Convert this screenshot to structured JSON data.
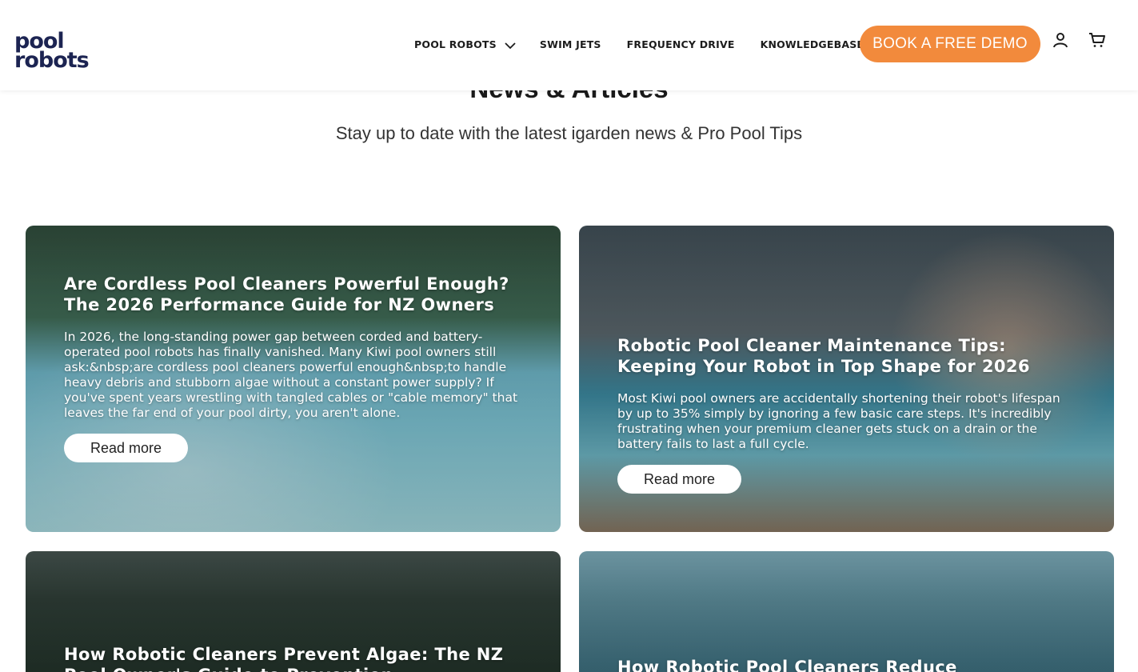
{
  "logo": {
    "line1": "pool",
    "line2": "robots"
  },
  "nav": {
    "items": [
      {
        "label": "POOL ROBOTS",
        "has_dropdown": true
      },
      {
        "label": "SWIM JETS"
      },
      {
        "label": "FREQUENCY DRIVE"
      },
      {
        "label": "KNOWLEDGEBASE"
      }
    ],
    "demo_button": "BOOK A FREE DEMO",
    "icons": [
      "account-icon",
      "cart-icon"
    ]
  },
  "hero": {
    "title": "News & Articles",
    "subtitle": "Stay up to date with the latest igarden news & Pro Pool Tips"
  },
  "articles": [
    {
      "title": "Are Cordless Pool Cleaners Powerful Enough? The 2026 Performance Guide for NZ Owners",
      "excerpt": "In 2026, the long-standing power gap between corded and battery-operated pool robots has finally vanished. Many Kiwi pool owners still ask:&nbsp;are cordless pool cleaners powerful enough&nbsp;to handle heavy debris and stubborn algae without a constant power supply? If you've spent years wrestling with tangled cables or \"cable memory\" that leaves the far end of your pool dirty, you aren't alone.",
      "cta": "Read more"
    },
    {
      "title": "Robotic Pool Cleaner Maintenance Tips: Keeping Your Robot in Top Shape for 2026",
      "excerpt": "Most Kiwi pool owners are accidentally shortening their robot's lifespan by up to 35% simply by ignoring a few basic care steps. It's incredibly frustrating when your premium cleaner gets stuck on a drain or the battery fails to last a full cycle.",
      "cta": "Read more"
    },
    {
      "title": "How Robotic Cleaners Prevent Algae: The NZ Pool Owner's Guide to Prevention",
      "excerpt": "",
      "cta": ""
    },
    {
      "title": "How Robotic Pool Cleaners Reduce",
      "excerpt": "",
      "cta": ""
    }
  ],
  "colors": {
    "brand_navy": "#1c2452",
    "brand_blue": "#2a9bd6",
    "cta_orange": "#f28a3c"
  }
}
